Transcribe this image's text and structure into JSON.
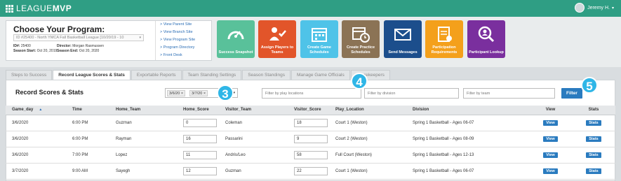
{
  "app": {
    "logo_part1": "LEAGUE",
    "logo_part2": "MVP",
    "user_name": "Jeremy H.",
    "caret": "▾"
  },
  "program": {
    "heading": "Choose Your Program:",
    "selected": "ID #25400 - North YMCA Fall Basketball League [10/20/19 - 10",
    "id_label": "ID#:",
    "id_value": "25400",
    "director_label": "Director:",
    "director_value": "Morgan Rasmussen",
    "start_label": "Season Start:",
    "start_value": "Oct 20, 2019",
    "end_label": "Season End:",
    "end_value": "Oct 20, 2020"
  },
  "quick_links": [
    "> View Parent Site",
    "> View Branch Site",
    "> View Program Site",
    "> Program Directory",
    "> Front Desk"
  ],
  "tiles": [
    {
      "label": "Success Snapshot",
      "color": "#59c19a",
      "icon": "gauge-icon"
    },
    {
      "label": "Assign Players to Teams",
      "color": "#e2552a",
      "icon": "assign-player-icon"
    },
    {
      "label": "Create Game Schedules",
      "color": "#4fc3e8",
      "icon": "calendar-icon"
    },
    {
      "label": "Create Practice Schedules",
      "color": "#8b7355",
      "icon": "calendar-clock-icon"
    },
    {
      "label": "Send Messages",
      "color": "#1c4e8c",
      "icon": "envelope-icon"
    },
    {
      "label": "Participation Requirements",
      "color": "#f4a01b",
      "icon": "checklist-icon"
    },
    {
      "label": "Participant Lookup",
      "color": "#7a2f9e",
      "icon": "magnifier-person-icon"
    }
  ],
  "tabs": [
    "Steps to Success",
    "Record League Scores & Stats",
    "Exportable Reports",
    "Team Standing Settings",
    "Season Standings",
    "Manage Game Officials",
    "Scorekeepers"
  ],
  "active_tab_index": 1,
  "scores": {
    "title": "Record Scores & Stats",
    "date_from": "3/6/20",
    "date_to": "3/7/20",
    "chip_x": "×",
    "date_caret": "▾",
    "location_placeholder": "Filter by play locations",
    "division_placeholder": "Filter by division",
    "team_placeholder": "Filter by team",
    "filter_label": "Filter"
  },
  "badges": [
    "3",
    "4",
    "5"
  ],
  "table": {
    "columns": [
      "Game_day",
      "Time",
      "Home_Team",
      "Home_Score",
      "Visitor_Team",
      "Visitor_Score",
      "Play_Location",
      "Division",
      "View",
      "Stats"
    ],
    "sort_arrow": "▲",
    "view_label": "View",
    "stats_label": "Stats",
    "rows": [
      {
        "day": "3/6/2020",
        "time": "6:00 PM",
        "home": "Guzman",
        "home_score": "0",
        "visitor": "Coleman",
        "visitor_score": "18",
        "location": "Court 1 (Weston)",
        "division": "Spring 1 Basketball - Ages 06-07"
      },
      {
        "day": "3/6/2020",
        "time": "6:00 PM",
        "home": "Rayman",
        "home_score": "16",
        "visitor": "Passarini",
        "visitor_score": "9",
        "location": "Court 2 (Weston)",
        "division": "Spring 1 Basketball - Ages 08-09"
      },
      {
        "day": "3/6/2020",
        "time": "7:00 PM",
        "home": "Lopez",
        "home_score": "11",
        "visitor": "Andris/Leo",
        "visitor_score": "58",
        "location": "Full Court (Weston)",
        "division": "Spring 1 Basketball - Ages 12-13"
      },
      {
        "day": "3/7/2020",
        "time": "9:00 AM",
        "home": "Sayegh",
        "home_score": "12",
        "visitor": "Guzman",
        "visitor_score": "22",
        "location": "Court 1 (Weston)",
        "division": "Spring 1 Basketball - Ages 06-07"
      }
    ]
  }
}
